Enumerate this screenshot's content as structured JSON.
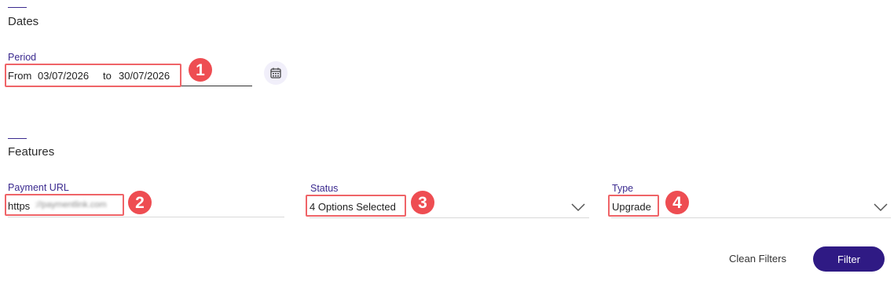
{
  "dates": {
    "title": "Dates",
    "period": {
      "label": "Period",
      "from_word": "From",
      "from_date": "03/07/2026",
      "to_word": "to",
      "to_date": "30/07/2026"
    },
    "calendar_icon": "calendar-icon"
  },
  "features": {
    "title": "Features",
    "payment_url": {
      "label": "Payment URL",
      "value_visible": "https",
      "value_blurred": "://paymentlink.com"
    },
    "status": {
      "label": "Status",
      "value": "4 Options Selected"
    },
    "type": {
      "label": "Type",
      "value": "Upgrade"
    }
  },
  "annotations": {
    "badge_1": "1",
    "badge_2": "2",
    "badge_3": "3",
    "badge_4": "4",
    "color": "#ee4d52"
  },
  "actions": {
    "clean_label": "Clean Filters",
    "filter_label": "Filter"
  },
  "colors": {
    "accent": "#3b2a8f",
    "primary_button": "#2f1a84",
    "highlight": "#ef6468"
  }
}
